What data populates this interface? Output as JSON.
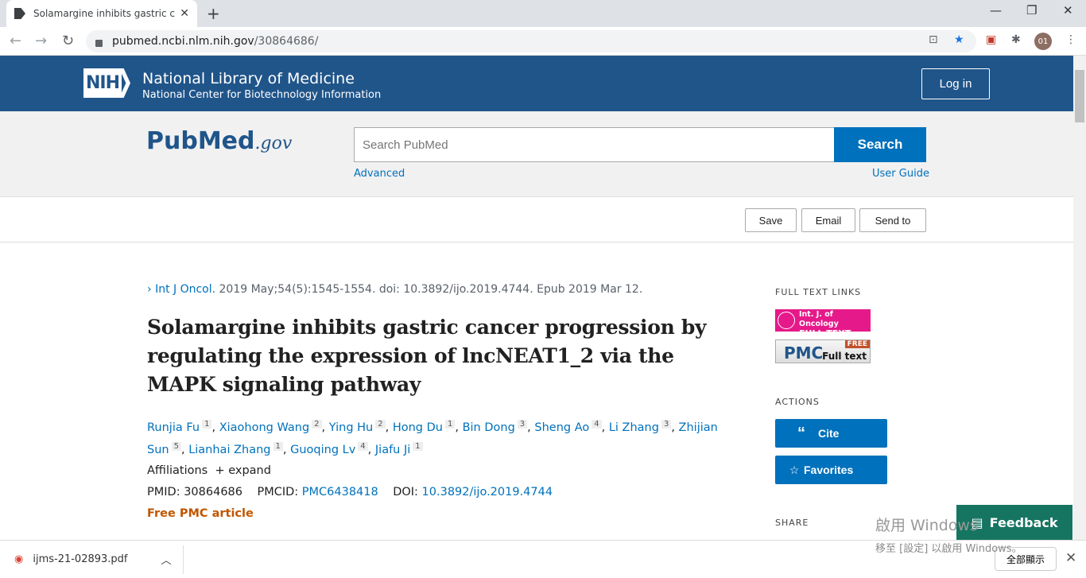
{
  "browser": {
    "tab_title": "Solamargine inhibits gastric cancer progression",
    "url_host": "pubmed.ncbi.nlm.nih.gov",
    "url_path": "/30864686/",
    "profile": "01"
  },
  "header": {
    "nih_logo": "NIH",
    "org_title": "National Library of Medicine",
    "org_subtitle": "National Center for Biotechnology Information",
    "login": "Log in"
  },
  "search": {
    "logo_pub": "Pub",
    "logo_med": "Med",
    "logo_gov": ".gov",
    "placeholder": "Search PubMed",
    "button": "Search",
    "advanced": "Advanced",
    "user_guide": "User Guide"
  },
  "toolbar": {
    "save": "Save",
    "email": "Email",
    "send_to": "Send to"
  },
  "article": {
    "journal": "Int J Oncol.",
    "citation": " 2019 May;54(5):1545-1554. doi: 10.3892/ijo.2019.4744. Epub 2019 Mar 12.",
    "title": "Solamargine inhibits gastric cancer progression by regulating the expression of lncNEAT1_2 via the MAPK signaling pathway",
    "authors": [
      {
        "name": "Runjia Fu",
        "aff": "1"
      },
      {
        "name": "Xiaohong Wang",
        "aff": "2"
      },
      {
        "name": "Ying Hu",
        "aff": "2"
      },
      {
        "name": "Hong Du",
        "aff": "1"
      },
      {
        "name": "Bin Dong",
        "aff": "3"
      },
      {
        "name": "Sheng Ao",
        "aff": "4"
      },
      {
        "name": "Li Zhang",
        "aff": "3"
      },
      {
        "name": "Zhijian Sun",
        "aff": "5"
      },
      {
        "name": "Lianhai Zhang",
        "aff": "1"
      },
      {
        "name": "Guoqing Lv",
        "aff": "4"
      },
      {
        "name": "Jiafu Ji",
        "aff": "1"
      }
    ],
    "affiliations_label": "Affiliations",
    "expand": "expand",
    "pmid_label": "PMID:",
    "pmid": "30864686",
    "pmcid_label": "PMCID:",
    "pmcid": "PMC6438418",
    "doi_label": "DOI:",
    "doi": "10.3892/ijo.2019.4744",
    "free_pmc": "Free PMC article"
  },
  "sidebar": {
    "full_text_links": "FULL TEXT LINKS",
    "ijo_line1": "Int. J. of Oncology",
    "ijo_line2": "FULL TEXT PDF",
    "pmc_logo": "PMC",
    "pmc_free": "FREE",
    "pmc_full_text": "Full text",
    "actions": "ACTIONS",
    "cite": "Cite",
    "favorites": "Favorites",
    "share": "SHARE"
  },
  "feedback": "Feedback",
  "watermark": {
    "line1": "啟用 Windows",
    "line2": "移至 [設定] 以啟用 Windows。"
  },
  "download": {
    "file": "ijms-21-02893.pdf",
    "show_all": "全部顯示"
  },
  "colors": {
    "nih_blue": "#20558a",
    "link": "#0071bc",
    "feedback": "#167561",
    "free_pmc": "#c05600"
  }
}
